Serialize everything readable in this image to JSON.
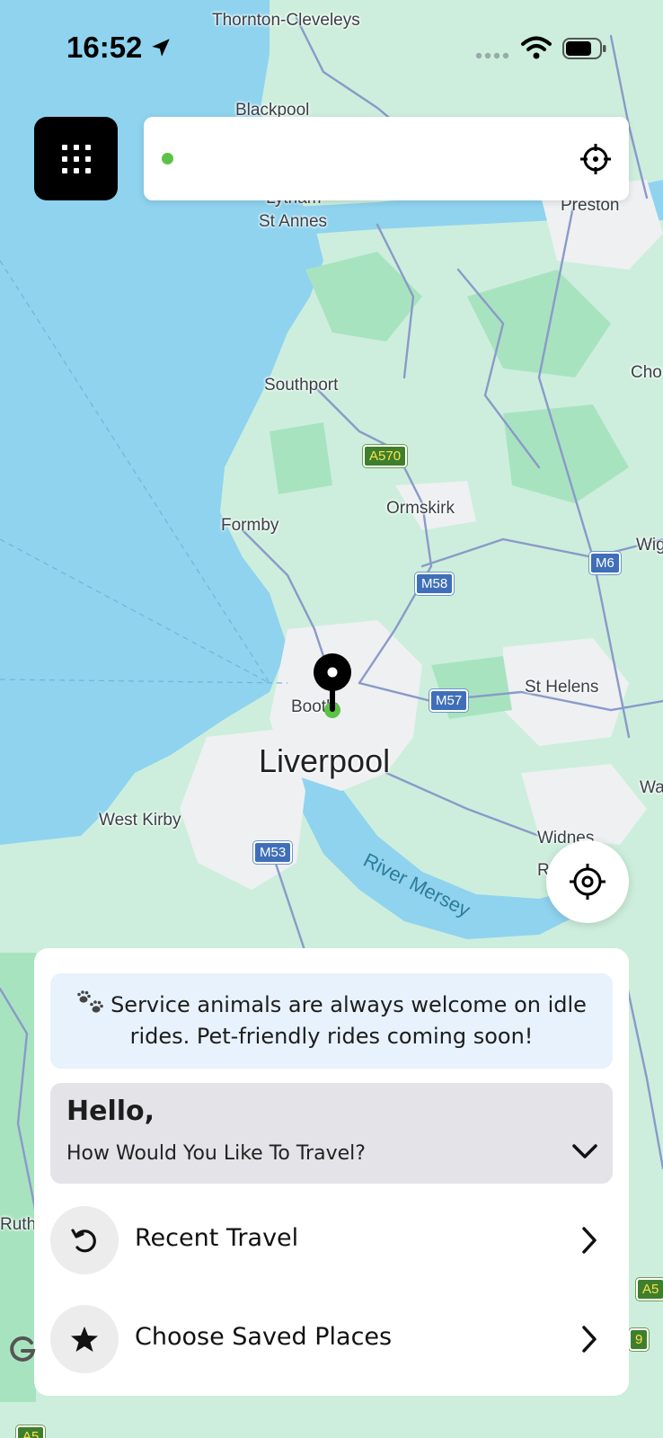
{
  "status_bar": {
    "time": "16:52",
    "icons": [
      "location-arrow-icon",
      "signal-dots-icon",
      "wifi-icon",
      "battery-icon"
    ]
  },
  "top_bar": {
    "menu_icon": "grid-icon",
    "search": {
      "value": "",
      "placeholder": "",
      "status_dot_color": "#5cc247",
      "target_icon": "crosshair-icon"
    }
  },
  "map": {
    "labels": {
      "thornton": "Thornton-Cleveleys",
      "blackpool": "Blackpool",
      "lytham": "Lytham",
      "stannes": "St Annes",
      "preston": "Preston",
      "cho": "Cho",
      "southport": "Southport",
      "formby": "Formby",
      "ormskirk": "Ormskirk",
      "wig": "Wig",
      "sthelens": "St Helens",
      "bootle": "Bootle",
      "liverpool": "Liverpool",
      "wa": "Wa",
      "westkirby": "West Kirby",
      "widnes": "Widnes",
      "r": "R",
      "river": "River Mersey",
      "ruth": "Ruth"
    },
    "roads": {
      "a570": "A570",
      "m58": "M58",
      "m6": "M6",
      "m57": "M57",
      "m53": "M53",
      "a5x": "A5",
      "nine": "9",
      "a5b": "A5"
    },
    "colors": {
      "sea": "#8fd3ef",
      "land": "#cdeedd",
      "green": "#a8e3c0",
      "urban": "#eef0f2",
      "road": "#8a9ac8"
    },
    "pin_color": "#000000",
    "pin_dot_color": "#5cc247"
  },
  "recenter": {
    "icon": "target-icon"
  },
  "sheet": {
    "notice": "Service animals are always welcome on idle rides. Pet-friendly rides coming soon!",
    "greeting_title": "Hello,",
    "greeting_subtitle": "How Would You Like To Travel?",
    "options": [
      {
        "label": "Recent Travel",
        "icon": "history-icon"
      },
      {
        "label": "Choose Saved Places",
        "icon": "star-icon"
      }
    ]
  },
  "colors": {
    "accent": "#5cc247",
    "notice_bg": "#e7f2fd",
    "card_bg": "#e4e4e8"
  }
}
